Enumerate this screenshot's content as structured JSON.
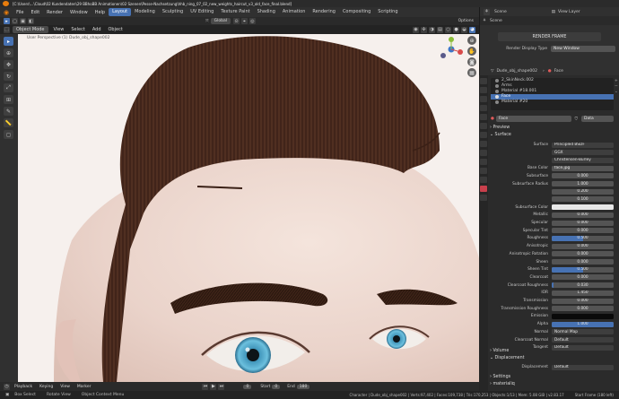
{
  "window": {
    "title": "[C:\\Users\\...\\Cloud\\02 Kundendaten\\29 BBhoBB Animationen\\02 Szenen\\Pesse-Nachsetzung\\hhb_ning_07_02_new_weights_haircut_v3_old_face_final.blend]"
  },
  "topbar": {
    "menus": [
      "File",
      "Edit",
      "Render",
      "Window",
      "Help"
    ],
    "workspaces": [
      "Layout",
      "Modeling",
      "Sculpting",
      "UV Editing",
      "Texture Paint",
      "Shading",
      "Animation",
      "Rendering",
      "Compositing",
      "Scripting"
    ],
    "active_workspace": "Layout"
  },
  "viewport": {
    "mode": "Object Mode",
    "menus": [
      "View",
      "Select",
      "Add",
      "Object"
    ],
    "orientation": "Global",
    "options_label": "Options",
    "info_text": "User Perspective (1) Dude_obj_shape002"
  },
  "scene_panel": {
    "scene_label": "Scene",
    "view_layer_label": "View Layer",
    "render_frame_label": "RENDER FRAME",
    "render_display_type_label": "Render Display Type",
    "render_display_type_value": "New Window"
  },
  "properties": {
    "breadcrumb_object": "Dude_obj_shape002",
    "breadcrumb_material": "Face",
    "material_slots": [
      "2_SkinNeck.002",
      "Arms",
      "Material #18.001",
      "Face",
      "Material #20"
    ],
    "selected_slot": "Face",
    "material_name": "Face",
    "data_label": "Data",
    "sections": {
      "preview": "Preview",
      "surface": "Surface",
      "volume": "Volume",
      "displacement": "Displacement",
      "settings": "Settings",
      "materialiq": "materialiq"
    },
    "rows": [
      {
        "label": "Surface",
        "value": "Principled BSDF"
      },
      {
        "label": "",
        "value": "GGX"
      },
      {
        "label": "",
        "value": "Christensen-Burley"
      },
      {
        "label": "Base Color",
        "value": "face.jpg"
      },
      {
        "label": "Subsurface",
        "value": "0.000"
      },
      {
        "label": "Subsurface Radius",
        "value": "1.000"
      },
      {
        "label": "",
        "value": "0.200"
      },
      {
        "label": "",
        "value": "0.100"
      },
      {
        "label": "Subsurface Color",
        "value": ""
      },
      {
        "label": "Metallic",
        "value": "0.000"
      },
      {
        "label": "Specular",
        "value": "0.000"
      },
      {
        "label": "Specular Tint",
        "value": "0.000"
      },
      {
        "label": "Roughness",
        "value": "0.500",
        "fill": 0.5
      },
      {
        "label": "Anisotropic",
        "value": "0.000"
      },
      {
        "label": "Anisotropic Rotation",
        "value": "0.000"
      },
      {
        "label": "Sheen",
        "value": "0.000"
      },
      {
        "label": "Sheen Tint",
        "value": "0.500",
        "fill": 0.5
      },
      {
        "label": "Clearcoat",
        "value": "0.000"
      },
      {
        "label": "Clearcoat Roughness",
        "value": "0.030",
        "fill": 0.03
      },
      {
        "label": "IOR",
        "value": "1.450"
      },
      {
        "label": "Transmission",
        "value": "0.000"
      },
      {
        "label": "Transmission Roughness",
        "value": "0.000"
      },
      {
        "label": "Emission",
        "value": ""
      },
      {
        "label": "Alpha",
        "value": "1.000",
        "fill": 1.0
      },
      {
        "label": "Normal",
        "value": "Normal Map"
      },
      {
        "label": "Clearcoat Normal",
        "value": "Default"
      },
      {
        "label": "Tangent",
        "value": "Default"
      }
    ],
    "displacement_label": "Displacement",
    "displacement_value": "Default"
  },
  "timeline": {
    "menus": [
      "Playback",
      "Keying",
      "View",
      "Marker"
    ],
    "current_frame": "0",
    "start_label": "Start",
    "start_value": "0",
    "end_label": "End",
    "end_value": "180"
  },
  "statusbar": {
    "select": "Box Select",
    "rotate": "Rotate View",
    "context": "Object Context Menu",
    "stats": "Character | Dude_obj_shape002 | Verts:97,402 | Faces:109,738 | Tris:170,253 | Objects:1/13 | Mem: 5.08 GiB | v2.83.17",
    "start_frame": "Start Frame (180 left)"
  },
  "colors": {
    "accent": "#4772b3",
    "hair": "#4a2a1d",
    "skin": "#ead6cf",
    "iris": "#4a9fc4"
  }
}
